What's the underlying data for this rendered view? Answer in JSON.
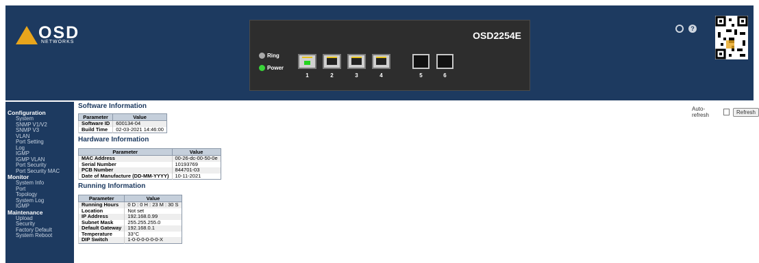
{
  "header": {
    "logo": {
      "brand": "OSD",
      "sub": "NETWORKS"
    },
    "model": "OSD2254E",
    "leds": [
      {
        "label": "Ring",
        "state": "off"
      },
      {
        "label": "Power",
        "state": "on"
      }
    ],
    "ports": [
      {
        "label": "1",
        "type": "rj45",
        "active": true
      },
      {
        "label": "2",
        "type": "rj45",
        "active": false
      },
      {
        "label": "3",
        "type": "rj45",
        "active": false
      },
      {
        "label": "4",
        "type": "rj45",
        "active": false
      },
      {
        "label": "5",
        "type": "sfp",
        "active": false
      },
      {
        "label": "6",
        "type": "sfp",
        "active": false
      }
    ],
    "icons": [
      "logout-icon",
      "help-icon",
      "qr-code"
    ]
  },
  "nav": {
    "sections": [
      {
        "title": "Configuration",
        "items": [
          "System",
          "SNMP V1/V2",
          "SNMP V3",
          "VLAN",
          "Port Setting",
          "Log",
          "IGMP",
          "IGMP VLAN",
          "Port Security",
          "Port Security MAC"
        ]
      },
      {
        "title": "Monitor",
        "items": [
          "System Info",
          "Port",
          "Topology",
          "System Log",
          "IGMP"
        ]
      },
      {
        "title": "Maintenance",
        "items": [
          "Upload",
          "Security",
          "Factory Default",
          "System Reboot"
        ]
      }
    ]
  },
  "software": {
    "title": "Software Information",
    "headers": [
      "Parameter",
      "Value"
    ],
    "rows": [
      [
        "Software ID",
        "600134-04"
      ],
      [
        "Build Time",
        "02-03-2021 14:46:00"
      ]
    ]
  },
  "hardware": {
    "title": "Hardware Information",
    "headers": [
      "Parameter",
      "Value"
    ],
    "rows": [
      [
        "MAC Address",
        "00-26-dc-00-50-0e"
      ],
      [
        "Serial Number",
        "10193769"
      ],
      [
        "PCB Number",
        "844701-03"
      ],
      [
        "Date of Manufacture (DD-MM-YYYY)",
        "10-11-2021"
      ]
    ]
  },
  "running": {
    "title": "Running Information",
    "headers": [
      "Parameter",
      "Value"
    ],
    "rows": [
      [
        "Running Hours",
        "0 D : 0 H : 23 M : 30 S"
      ],
      [
        "Location",
        "Not set"
      ],
      [
        "IP Address",
        "192.168.0.99"
      ],
      [
        "Subnet Mask",
        "255.255.255.0"
      ],
      [
        "Default Gateway",
        "192.168.0.1"
      ],
      [
        "Temperature",
        "33°C"
      ],
      [
        "DIP Switch",
        "1-0-0-0-0-0-0-X"
      ]
    ]
  },
  "toolbar": {
    "auto_refresh_label": "Auto-refresh",
    "auto_refresh_checked": false,
    "refresh_label": "Refresh"
  },
  "colors": {
    "header_bg": "#1d3a60",
    "logo_accent": "#e8a51c",
    "power_led": "#3ad43a"
  }
}
